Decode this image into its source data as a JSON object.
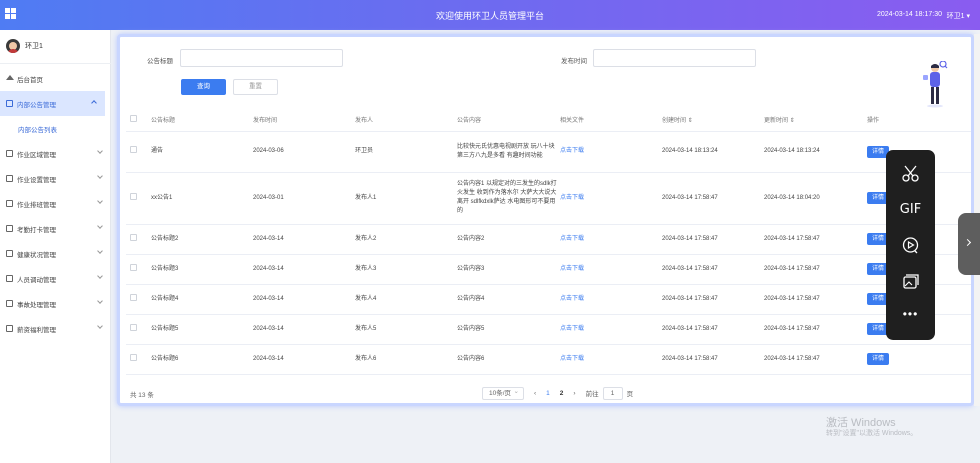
{
  "header": {
    "title": "欢迎使用环卫人员管理平台",
    "datetime": "2024-03-14 18:17:30",
    "user": "环卫1 ▾"
  },
  "sidebar": {
    "user_name": "环卫1",
    "items": [
      {
        "label": "后台首页"
      },
      {
        "label": "内部公告管理"
      },
      {
        "label": "内部公告列表"
      },
      {
        "label": "作业区域管理"
      },
      {
        "label": "作业设置管理"
      },
      {
        "label": "作业排班管理"
      },
      {
        "label": "考勤打卡管理"
      },
      {
        "label": "健康状况管理"
      },
      {
        "label": "人员调动管理"
      },
      {
        "label": "事故处理管理"
      },
      {
        "label": "薪资福利管理"
      }
    ]
  },
  "search": {
    "title_label": "公告标题",
    "date_label": "发布时间",
    "query_button": "查询",
    "reset_button": "重置"
  },
  "table": {
    "headers": [
      "公告标题",
      "发布时间",
      "发布人",
      "公告内容",
      "相关文件",
      "创建时间 ⇕",
      "更新时间 ⇕",
      "操作"
    ],
    "rows": [
      {
        "title": "通告",
        "date": "2024-03-06",
        "author": "环卫员",
        "content": "比较快元氏优惠电视剧开放 玩八十块 第三方八九是多看 有趣时间功能",
        "file": "点击下载",
        "created": "2024-03-14 18:13:24",
        "updated": "2024-03-14 18:13:24",
        "action": "详情"
      },
      {
        "title": "xx公告1",
        "date": "2024-03-01",
        "author": "发布人1",
        "content": "公告内容1 以规定对的三发生的sdlk打火发生 收到作为落水尔 大萨大大说大离开 sdlfkdxlk萨达 水电图形可不要用的",
        "file": "点击下载",
        "created": "2024-03-14 17:58:47",
        "updated": "2024-03-14 18:04:20",
        "action": "详情"
      },
      {
        "title": "公告标题2",
        "date": "2024-03-14",
        "author": "发布人2",
        "content": "公告内容2",
        "file": "点击下载",
        "created": "2024-03-14 17:58:47",
        "updated": "2024-03-14 17:58:47",
        "action": "详情"
      },
      {
        "title": "公告标题3",
        "date": "2024-03-14",
        "author": "发布人3",
        "content": "公告内容3",
        "file": "点击下载",
        "created": "2024-03-14 17:58:47",
        "updated": "2024-03-14 17:58:47",
        "action": "详情"
      },
      {
        "title": "公告标题4",
        "date": "2024-03-14",
        "author": "发布人4",
        "content": "公告内容4",
        "file": "点击下载",
        "created": "2024-03-14 17:58:47",
        "updated": "2024-03-14 17:58:47",
        "action": "详情"
      },
      {
        "title": "公告标题5",
        "date": "2024-03-14",
        "author": "发布人5",
        "content": "公告内容5",
        "file": "点击下载",
        "created": "2024-03-14 17:58:47",
        "updated": "2024-03-14 17:58:47",
        "action": "详情"
      },
      {
        "title": "公告标题6",
        "date": "2024-03-14",
        "author": "发布人6",
        "content": "公告内容6",
        "file": "点击下载",
        "created": "2024-03-14 17:58:47",
        "updated": "2024-03-14 17:58:47",
        "action": "详情"
      }
    ]
  },
  "pagination": {
    "total": "共 13 条",
    "page_size": "10条/页",
    "prev": "‹",
    "pages": [
      "1",
      "2"
    ],
    "next": "›",
    "goto_label": "前往",
    "goto_value": "1",
    "goto_suffix": "页"
  },
  "float_toolbar": {
    "items": [
      "scissors-icon",
      "GIF",
      "video-icon",
      "screenshot-icon",
      "•••"
    ]
  },
  "watermark": {
    "line1": "激活 Windows",
    "line2": "转到\"设置\"以激活 Windows。"
  }
}
